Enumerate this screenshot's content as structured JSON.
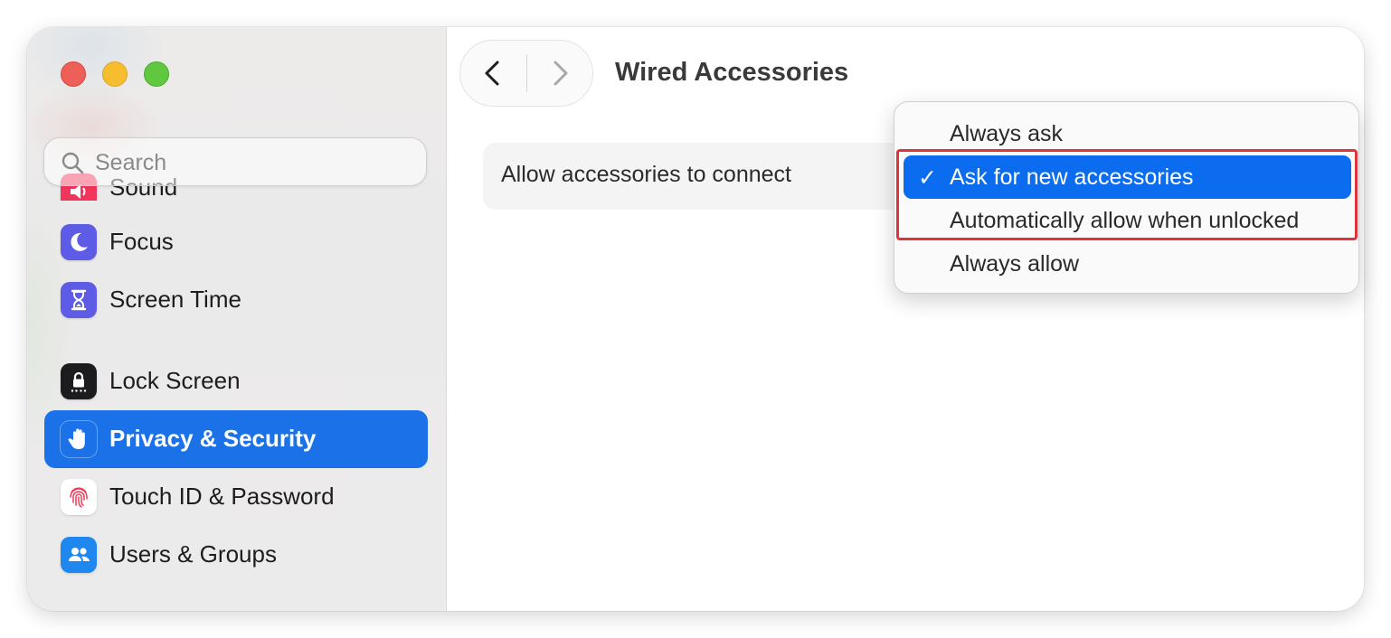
{
  "window": {
    "controls": [
      "close",
      "minimize",
      "maximize"
    ]
  },
  "sidebar": {
    "search": {
      "placeholder": "Search"
    },
    "items": [
      {
        "label": "Sound",
        "icon": "speaker-icon",
        "color": "#f2355b"
      },
      {
        "label": "Focus",
        "icon": "moon-icon",
        "color": "#5e5ce6"
      },
      {
        "label": "Screen Time",
        "icon": "hourglass-icon",
        "color": "#5e5ce6"
      },
      {
        "label": "Lock Screen",
        "icon": "lock-icon",
        "color": "#1c1c1e"
      },
      {
        "label": "Privacy & Security",
        "icon": "hand-icon",
        "color": "#1b71e8",
        "active": true
      },
      {
        "label": "Touch ID & Password",
        "icon": "fingerprint-icon",
        "color": "#ffffff"
      },
      {
        "label": "Users & Groups",
        "icon": "users-icon",
        "color": "#1e88f0"
      }
    ]
  },
  "main": {
    "title": "Wired Accessories",
    "setting": {
      "label": "Allow accessories to connect"
    }
  },
  "dropdown": {
    "options": [
      {
        "label": "Always ask"
      },
      {
        "label": "Ask for new accessories",
        "selected": true
      },
      {
        "label": "Automatically allow when unlocked"
      },
      {
        "label": "Always allow"
      }
    ],
    "check": "✓"
  },
  "colors": {
    "accent": "#1b71e8",
    "menu_selection": "#0b6cf0",
    "highlight": "#e0343c"
  }
}
